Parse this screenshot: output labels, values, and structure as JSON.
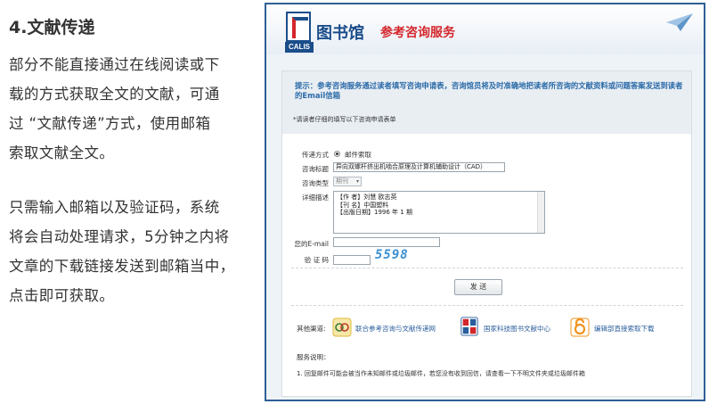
{
  "article": {
    "heading": "4.文献传递",
    "para1": [
      "部分不能直接通过在线阅读或下",
      "载的方式获取全文的文献，可通",
      "过 “文献传递”方式，使用邮箱",
      "索取文献全文。"
    ],
    "para2": [
      "只需输入邮箱以及验证码，系统",
      "将会自动处理请求，5分钟之内将",
      "文章的下载链接发送到邮箱当中，",
      "点击即可获取。"
    ]
  },
  "screenshot": {
    "logo_text": "CALIS",
    "title_main": "图书馆",
    "title_sub": "参考咨询服务",
    "notice": "提示：参考咨询服务通过读者填写咨询申请表，咨询馆员将及时准确地把读者所咨询的文献资料或问题答案发送到读者的Email信箱",
    "notice_sub": "*请读者仔细的填写以下咨询申请表单",
    "form": {
      "delivery_label": "传递方式",
      "delivery_option": "邮件索取",
      "subject_label": "咨询标题",
      "subject_value": "异向双螺杆挤出机啮合原理及计算机辅助设计（CAD）",
      "type_label": "咨询类型",
      "type_value": "期刊",
      "detail_label": "详细描述",
      "detail_lines": [
        "【作 者】刘慧 欧志英",
        "【刊 名】中国塑料",
        "【出版日期】1996 年 1 期"
      ],
      "email_label": "您的E-mail",
      "email_value": "",
      "captcha_label": "验 证 码",
      "captcha_value": "",
      "captcha_image_text": "5598",
      "submit_label": "发 送"
    },
    "channels": {
      "label": "其他渠道:",
      "items": [
        {
          "name": "联合参考咨询与文献传递网",
          "icon": "ucdrs-logo-icon",
          "color": "#e0b93b"
        },
        {
          "name": "国家科技图书文献中心",
          "icon": "nstl-logo-icon",
          "color": "#2a5d9c"
        },
        {
          "name": "编辑部直接索取下载",
          "icon": "open-access-icon",
          "color": "#f0931f"
        }
      ]
    },
    "service_note_title": "服务说明：",
    "service_note": "1. 回复邮件可能会被当作未知邮件或垃圾邮件，若您没有收到回信，请查看一下不明文件夹或垃圾邮件箱"
  },
  "colors": {
    "frame_border": "#2f5f95",
    "brand_blue": "#1b4d8a",
    "brand_red": "#d3262b",
    "notice_text": "#2a6aa8",
    "captcha": "#3a8fd0"
  }
}
